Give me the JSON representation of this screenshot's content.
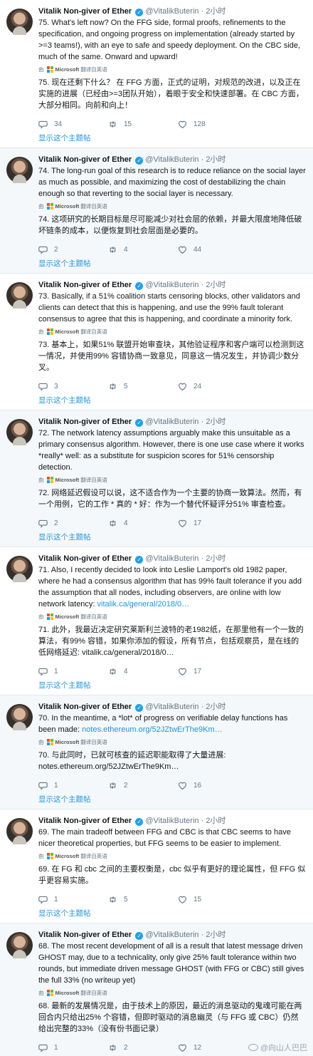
{
  "author": {
    "name": "Vitalik Non-giver of Ether",
    "handle": "@VitalikButerin",
    "separator": "·",
    "time": "2小时",
    "verified_glyph": "✓"
  },
  "translate": {
    "prefix": "由",
    "brand": "Microsoft",
    "suffix": "翻译自英语"
  },
  "show_thread_label": "显示这个主题帖",
  "colors": {
    "link": "#1b95e0",
    "verified": "#1da1f2",
    "muted": "#657786"
  },
  "icons": [
    "reply-icon",
    "retweet-icon",
    "like-icon"
  ],
  "tweets": [
    {
      "text": "75. What's left now? On the FFG side, formal proofs, refinements to the specification, and ongoing progress on implementation (already started by >=3 teams!), with an eye to safe and speedy deployment. On the CBC side, much of the same. Onward and upward!",
      "link": "",
      "translated": "75. 现在还剩下什么？ 在 FFG 方面，正式的证明，对规范的改进，以及正在实施的进展（已经由>=3团队开始），着眼于安全和快速部署。在 CBC 方面，大部分相同。向前和向上！",
      "replies": "34",
      "retweets": "15",
      "likes": "128"
    },
    {
      "text": "74. The long-run goal of this research is to reduce reliance on the social layer as much as possible, and maximizing the cost of destabilizing the chain enough so that reverting to the social layer is necessary.",
      "link": "",
      "translated": "74. 这项研究的长期目标是尽可能减少对社会层的依赖，并最大限度地降低破坏链条的成本，以便恢复到社会层面是必要的。",
      "replies": "2",
      "retweets": "4",
      "likes": "44"
    },
    {
      "text": "73. Basically, if a 51% coalition starts censoring blocks, other validators and clients can detect that this is happening, and use the 99% fault tolerant consensus to agree that this is happening, and coordinate a minority fork.",
      "link": "",
      "translated": "73. 基本上，如果51% 联盟开始审查块，其他验证程序和客户端可以检测到这一情况，并使用99% 容错协商一致意见，同意这一情况发生，并协调少数分叉。",
      "replies": "3",
      "retweets": "5",
      "likes": "24"
    },
    {
      "text": "72. The network latency assumptions arguably make this unsuitable as a primary consensus algorithm. However, there is one use case where it works *really* well: as a substitute for suspicion scores for 51% censorship detection.",
      "link": "",
      "translated": "72. 网络延迟假设可以说，这不适合作为一个主要的协商一致算法。然而，有一个用例，它的工作 * 真的 * 好：作为一个替代怀疑评分51% 审查检查。",
      "replies": "2",
      "retweets": "4",
      "likes": "17"
    },
    {
      "text": "71. Also, I recently decided to look into Leslie Lamport's old 1982 paper, where he had a consensus algorithm that has 99% fault tolerance if you add the assumption that all nodes, including observers, are online with low network latency: ",
      "link": "vitalik.ca/general/2018/0…",
      "translated": "71. 此外，我最近决定研究莱斯利兰波特的老1982纸，在那里他有一个一致的算法，有99% 容错，如果你添加的假设，所有节点，包括观察员，是在线的低网络延迟: vitalik.ca/general/2018/0…",
      "replies": "1",
      "retweets": "4",
      "likes": "17"
    },
    {
      "text": "70. In the meantime, a *lot* of progress on verifiable delay functions has been made: ",
      "link": "notes.ethereum.org/52JZtwErThe9Km…",
      "translated": "70. 与此同时，已就可核查的延迟职能取得了大量进展: notes.ethereum.org/52JZtwErThe9Km…",
      "replies": "1",
      "retweets": "2",
      "likes": "16"
    },
    {
      "text": "69. The main tradeoff between FFG and CBC is that CBC seems to have nicer theoretical properties, but FFG seems to be easier to implement.",
      "link": "",
      "translated": "69. 在 FG 和 cbc 之间的主要权衡是，cbc 似乎有更好的理论属性，但 FFG 似乎更容易实施。",
      "replies": "1",
      "retweets": "5",
      "likes": "15"
    },
    {
      "text": "68. The most recent development of all is a result that latest message driven GHOST may, due to a technicality, only give 25% fault tolerance within two rounds, but immediate driven message GHOST (with FFG or CBC) still gives the full 33% (no writeup yet)",
      "link": "",
      "translated": "68. 最新的发展情况是，由于技术上的原因，最近的消息驱动的鬼魂可能在两回合内只给出25% 个容错，但即时驱动的消息幽灵（与 FFG 或 CBC）仍然给出完整的33%（没有份书面记录）",
      "replies": "1",
      "retweets": "2",
      "likes": "12"
    }
  ],
  "watermark": "@向山人巴巴"
}
